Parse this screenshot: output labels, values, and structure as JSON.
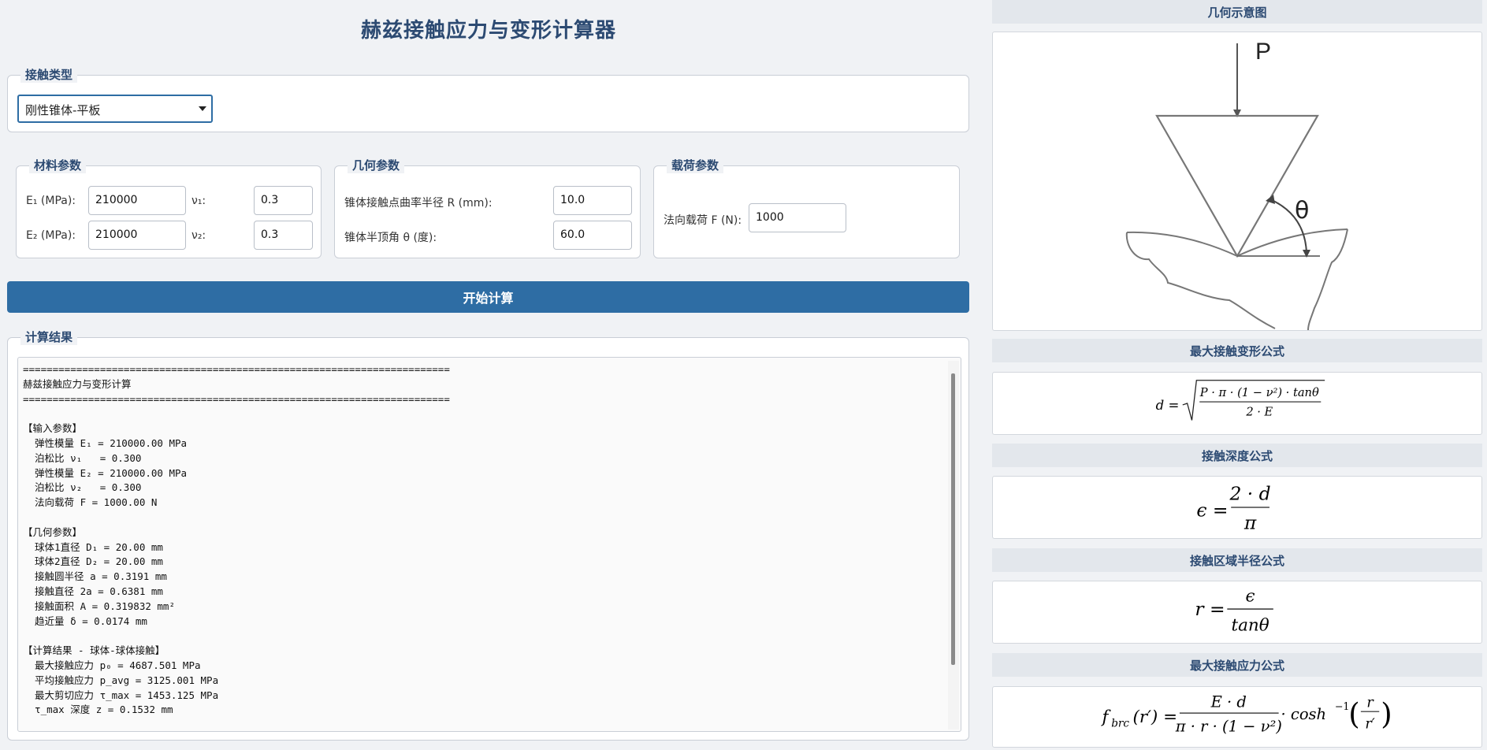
{
  "app": {
    "title": "赫兹接触应力与变形计算器"
  },
  "contact_type": {
    "title": "接触类型",
    "selected": "刚性锥体-平板"
  },
  "material": {
    "title": "材料参数",
    "e1_label": "E₁ (MPa):",
    "e1_value": "210000",
    "v1_label": "ν₁:",
    "v1_value": "0.3",
    "e2_label": "E₂ (MPa):",
    "e2_value": "210000",
    "v2_label": "ν₂:",
    "v2_value": "0.3"
  },
  "geometry": {
    "title": "几何参数",
    "r_label": "锥体接触点曲率半径 R (mm):",
    "r_value": "10.0",
    "theta_label": "锥体半顶角 θ (度):",
    "theta_value": "60.0"
  },
  "load": {
    "title": "载荷参数",
    "f_label": "法向载荷 F (N):",
    "f_value": "1000"
  },
  "actions": {
    "calculate": "开始计算"
  },
  "results": {
    "title": "计算结果",
    "lines": [
      "========================================================================",
      "赫兹接触应力与变形计算",
      "========================================================================",
      "",
      "【输入参数】",
      "  弹性模量 E₁ = 210000.00 MPa",
      "  泊松比 ν₁   = 0.300",
      "  弹性模量 E₂ = 210000.00 MPa",
      "  泊松比 ν₂   = 0.300",
      "  法向载荷 F = 1000.00 N",
      "",
      "【几何参数】",
      "  球体1直径 D₁ = 20.00 mm",
      "  球体2直径 D₂ = 20.00 mm",
      "  接触圆半径 a = 0.3191 mm",
      "  接触直径 2a = 0.6381 mm",
      "  接触面积 A = 0.319832 mm²",
      "  趋近量 δ = 0.0174 mm",
      "",
      "【计算结果 - 球体-球体接触】",
      "  最大接触应力 p₀ = 4687.501 MPa",
      "  平均接触应力 p_avg = 3125.001 MPa",
      "  最大剪切应力 τ_max = 1453.125 MPa",
      "  τ_max 深度 z = 0.1532 mm",
      "",
      "========================================================================"
    ]
  },
  "side": {
    "diagram_title": "几何示意图",
    "diagram_labels": {
      "load": "P",
      "angle": "θ"
    },
    "deform_title": "最大接触变形公式",
    "deform_formula": {
      "lhs": "d =",
      "num": "P · π · (1 − ν²) · tanθ",
      "den": "2 · E"
    },
    "depth_title": "接触深度公式",
    "depth_formula": {
      "lhs": "ϵ =",
      "num": "2 · d",
      "den": "π"
    },
    "radius_title": "接触区域半径公式",
    "radius_formula": {
      "lhs": "r =",
      "num": "ϵ",
      "den": "tanθ"
    },
    "stress_title": "最大接触应力公式",
    "stress_formula": {
      "lhs": "f",
      "lhs_sub": "brc",
      "lhs_arg": "(r′) =",
      "num": "E · d",
      "den": "π · r · (1 − ν²)",
      "mid": "· cosh",
      "sup": "−1",
      "frac_num": "r",
      "frac_den": "r′"
    }
  }
}
